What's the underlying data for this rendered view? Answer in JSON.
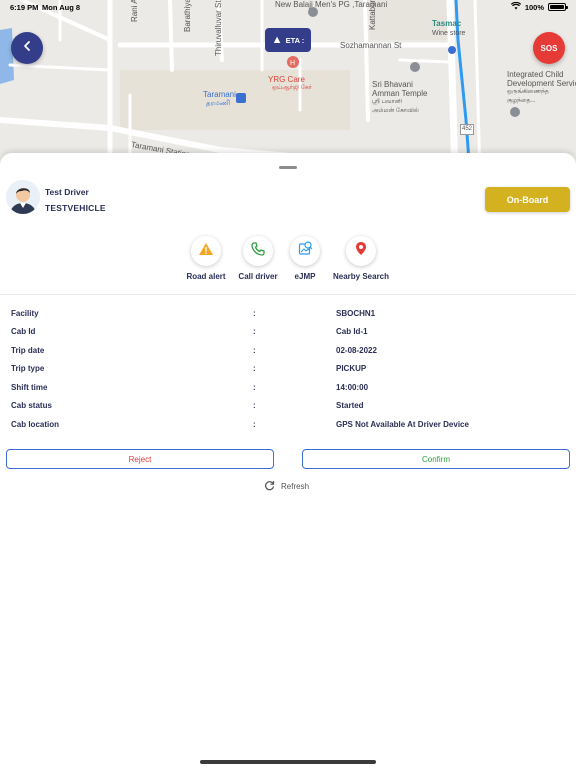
{
  "status_bar": {
    "time": "6:19 PM",
    "date": "Mon Aug 8",
    "battery": "100%"
  },
  "map": {
    "labels": {
      "pg": "New Balaji Men's\nPG ,Taramani",
      "tasmac": "Tasmac",
      "wine_store": "Wine store",
      "sozhamannan": "Sozhamannan St",
      "yrg_care": "YRG Care",
      "yrg_care_ta": "ஒய்ஆர்ஜி கேர்",
      "taramani": "Taramani",
      "taramani_ta": "தரமணி",
      "bhavani": "Sri Bhavani\nAmman Temple",
      "bhavani_ta": "ஸ்ரீ பவானி\nஅம்மன் கோவில்",
      "icds": "Integrated Child\nDevelopment Service",
      "icds_ta": "ஒருங்கிணைந்த\nகுழந்தை...",
      "bharathiyar": "Barathiyar St",
      "thiruvalluvar": "Thiruvalluvar St",
      "rani": "Rani A",
      "kattabom": "Kattabom",
      "station": "Taramani Station",
      "road_no": "452"
    },
    "eta_label": "ETA :",
    "sos_label": "SOS"
  },
  "driver": {
    "name": "Test Driver",
    "vehicle": "TESTVEHICLE"
  },
  "onboard_label": "On-Board",
  "actions": [
    {
      "label": "Road alert",
      "icon": "warning-icon"
    },
    {
      "label": "Call driver",
      "icon": "phone-icon"
    },
    {
      "label": "eJMP",
      "icon": "ejmp-icon"
    },
    {
      "label": "Nearby Search",
      "icon": "location-pin-icon"
    }
  ],
  "trip_info": [
    {
      "key": "Facility",
      "value": "SBOCHN1"
    },
    {
      "key": "Cab Id",
      "value": "Cab Id-1"
    },
    {
      "key": "Trip date",
      "value": "02-08-2022"
    },
    {
      "key": "Trip type",
      "value": "PICKUP"
    },
    {
      "key": "Shift time",
      "value": "14:00:00"
    },
    {
      "key": "Cab status",
      "value": "Started"
    },
    {
      "key": "Cab location",
      "value": "GPS Not Available At Driver Device"
    }
  ],
  "separator": ":",
  "reject_label": "Reject",
  "confirm_label": "Confirm",
  "refresh_label": "Refresh",
  "colors": {
    "primary": "#343d8a",
    "sos": "#e53a35",
    "onboard": "#d4b21f",
    "confirm": "#2e9e3f",
    "reject": "#e53a35",
    "route": "#2f9bf0"
  }
}
